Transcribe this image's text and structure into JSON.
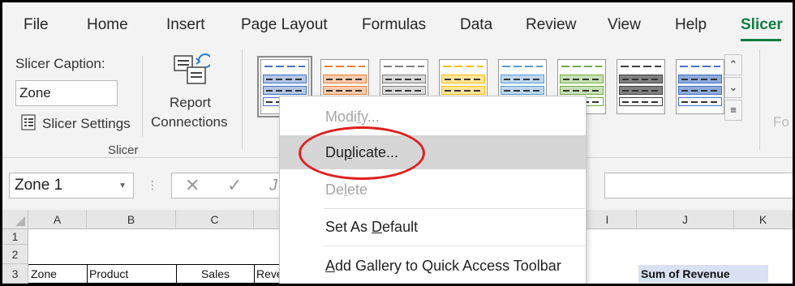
{
  "tabs": [
    {
      "label": "File",
      "active": false
    },
    {
      "label": "Home",
      "active": false
    },
    {
      "label": "Insert",
      "active": false
    },
    {
      "label": "Page Layout",
      "active": false
    },
    {
      "label": "Formulas",
      "active": false
    },
    {
      "label": "Data",
      "active": false
    },
    {
      "label": "Review",
      "active": false
    },
    {
      "label": "View",
      "active": false
    },
    {
      "label": "Help",
      "active": false
    },
    {
      "label": "Slicer",
      "active": true
    }
  ],
  "ribbon": {
    "caption_label": "Slicer Caption:",
    "caption_value": "Zone",
    "slicer_settings_label": "Slicer Settings",
    "report_connections_line1": "Report",
    "report_connections_line2": "Connections",
    "group_slicer_label": "Slicer",
    "cut_off_text": "Fo"
  },
  "styles_gallery": {
    "swatches": [
      {
        "name": "light-1",
        "accent": "#4472c4",
        "band": "#b4c6e7"
      },
      {
        "name": "light-2",
        "accent": "#ed7d31",
        "band": "#f8cbad"
      },
      {
        "name": "light-3",
        "accent": "#7f7f7f",
        "band": "#d9d9d9"
      },
      {
        "name": "light-4",
        "accent": "#ffc000",
        "band": "#ffe699"
      },
      {
        "name": "light-5",
        "accent": "#5b9bd5",
        "band": "#bdd7ee"
      },
      {
        "name": "light-6",
        "accent": "#70ad47",
        "band": "#c6e0b4"
      },
      {
        "name": "dark-1",
        "accent": "#404040",
        "band": "#808080"
      },
      {
        "name": "dark-2",
        "accent": "#4472c4",
        "band": "#8ea9db"
      }
    ]
  },
  "formula_bar": {
    "name_box": "Zone 1",
    "cancel_icon": "close-icon",
    "enter_icon": "check-icon",
    "fx_partial": "J"
  },
  "sheet": {
    "columns": [
      "A",
      "B",
      "C",
      "",
      "I",
      "J",
      "K"
    ],
    "rows": [
      "1",
      "2",
      "3"
    ],
    "row3": {
      "a": "Zone",
      "b": "Product",
      "c": "Sales",
      "d": "Reve",
      "j": "Sum of Revenue"
    }
  },
  "context_menu": {
    "items": [
      {
        "label_pre": "Modi",
        "label_ul": "f",
        "label_post": "y...",
        "state": "disabled"
      },
      {
        "label_pre": "Du",
        "label_ul": "p",
        "label_post": "licate...",
        "state": "highlight"
      },
      {
        "label_pre": "De",
        "label_ul": "l",
        "label_post": "ete",
        "state": "disabled"
      },
      {
        "label_pre": "Set As ",
        "label_ul": "D",
        "label_post": "efault",
        "state": "normal"
      },
      {
        "label_pre": "",
        "label_ul": "A",
        "label_post": "dd Gallery to Quick Access Toolbar",
        "state": "normal"
      }
    ]
  },
  "colors": {
    "accent": "#107c41",
    "annotation": "#e02020",
    "pivot_header": "#d9e1f2"
  }
}
